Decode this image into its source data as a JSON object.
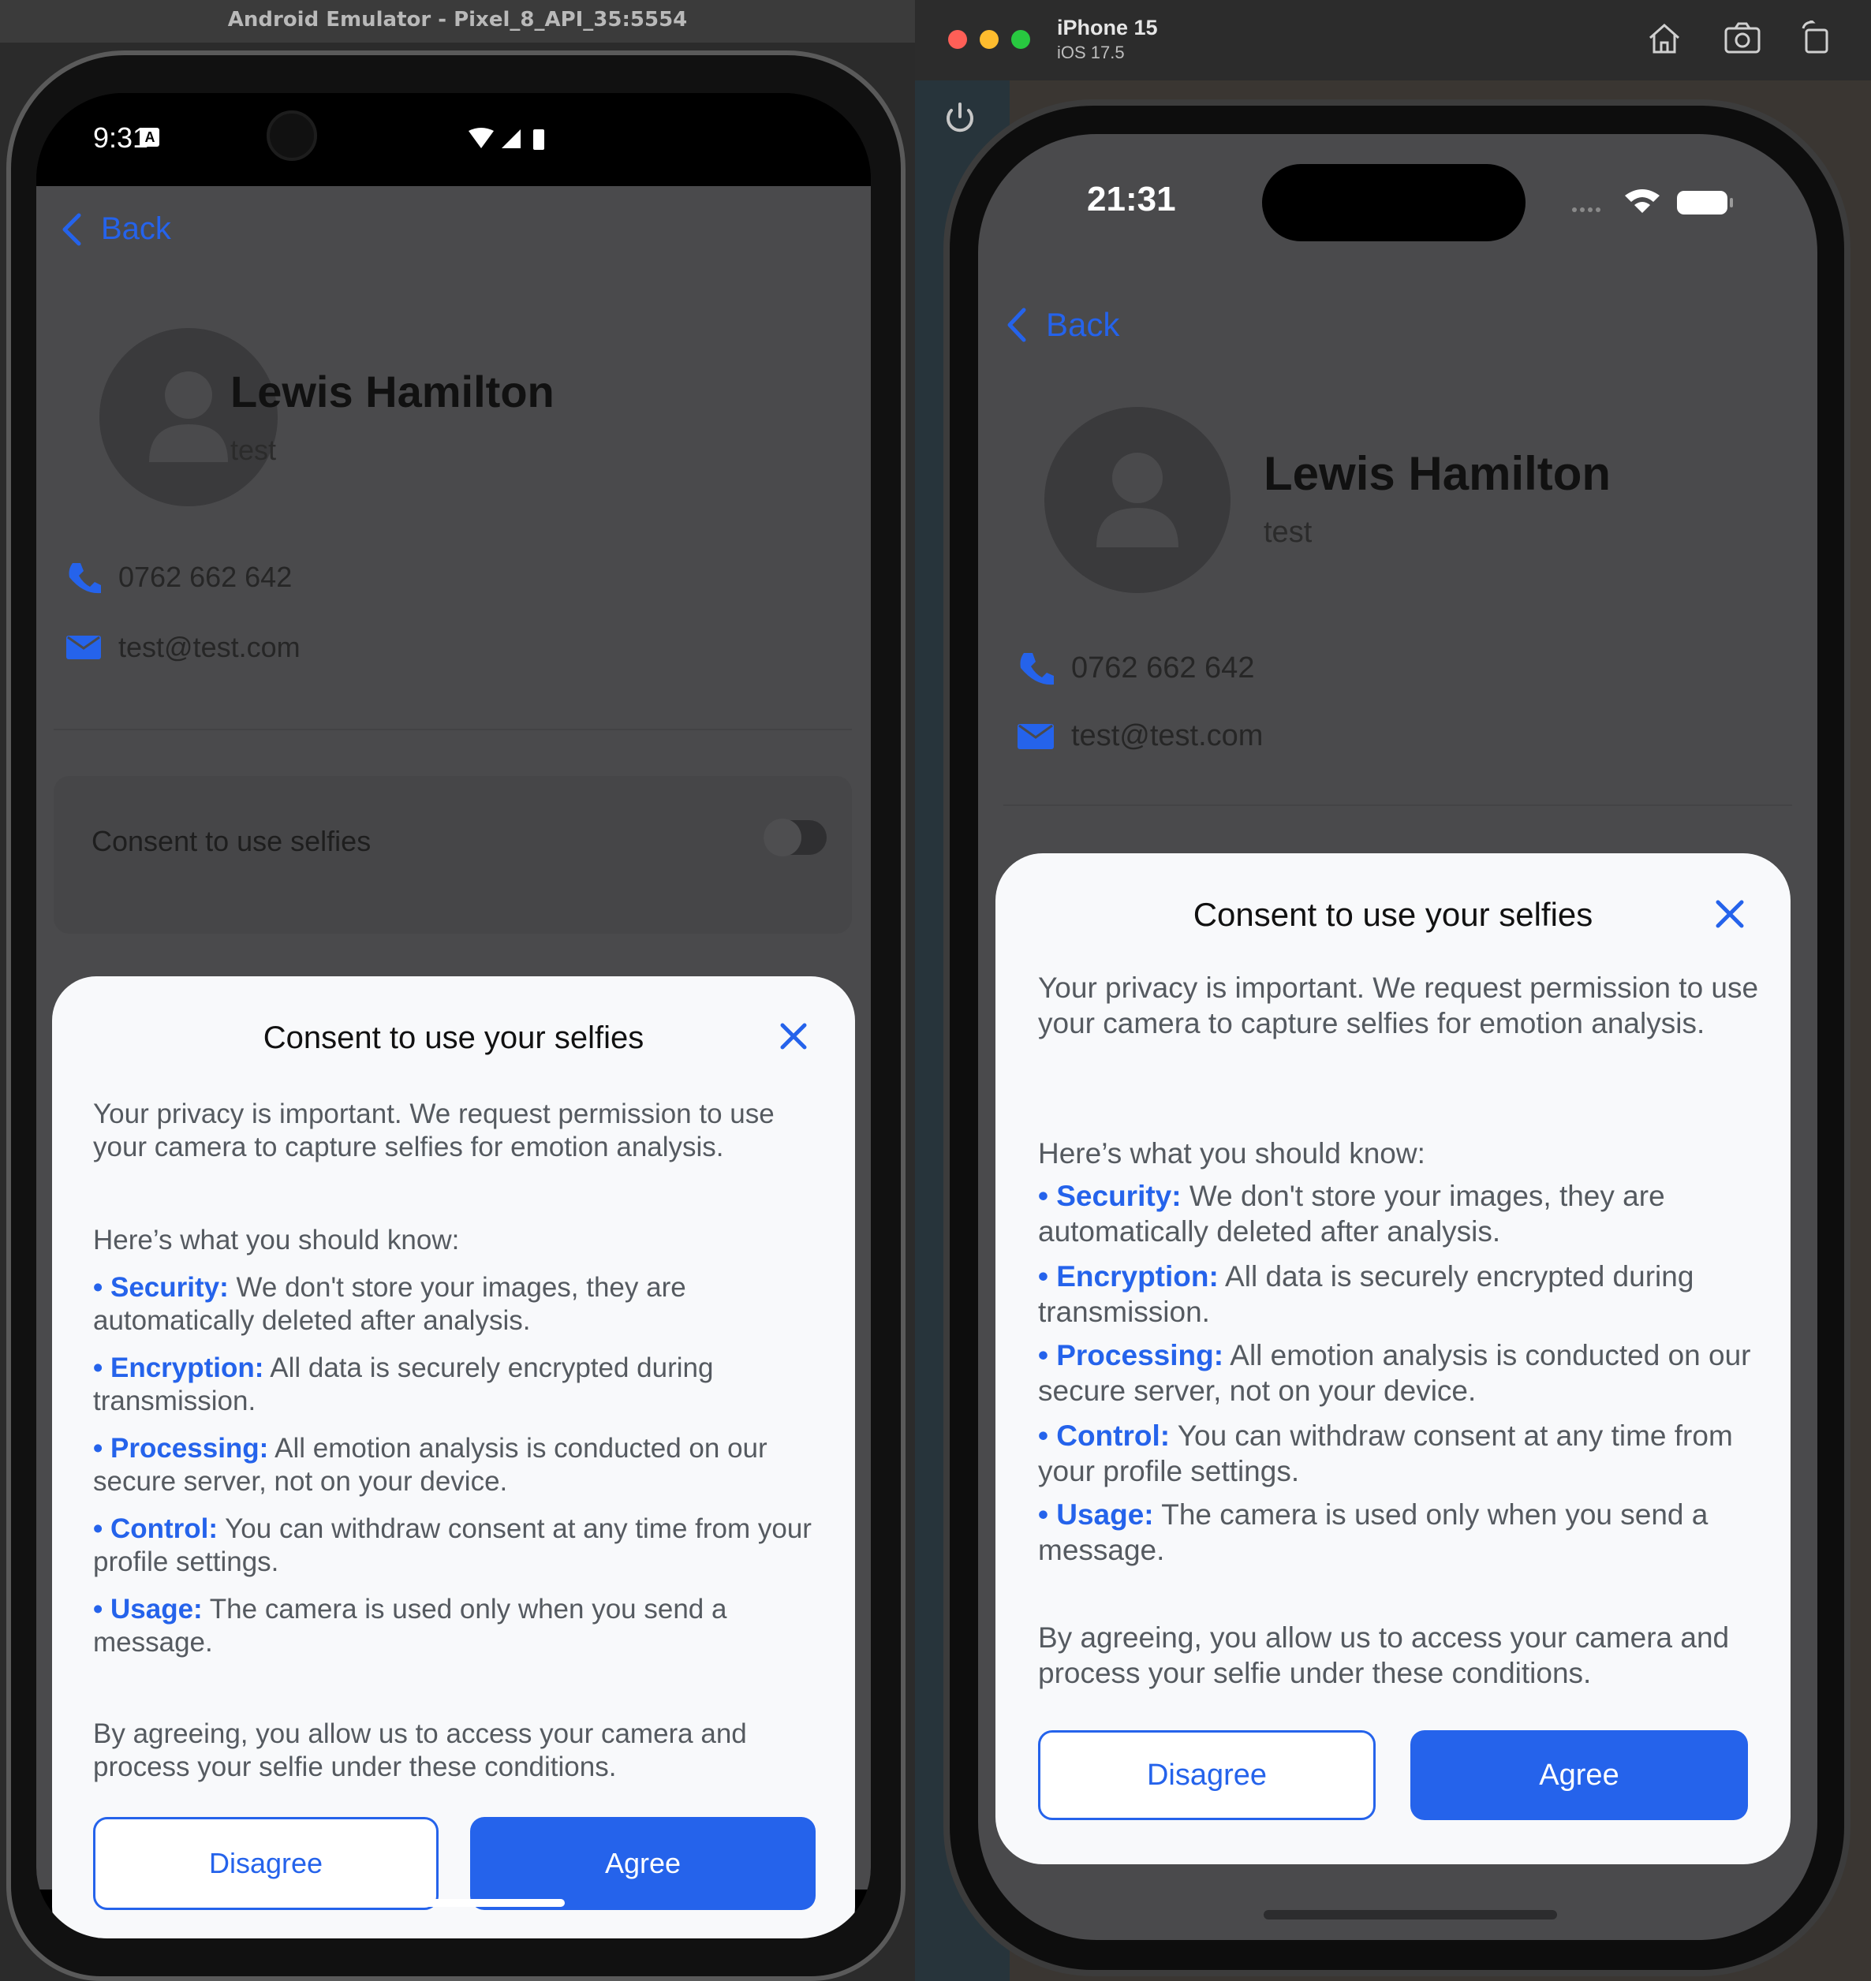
{
  "android": {
    "window_title": "Android Emulator - Pixel_8_API_35:5554",
    "status_time": "9:31",
    "status_notif": "A"
  },
  "ios": {
    "device_name": "iPhone 15",
    "os_version": "iOS 17.5",
    "status_time": "21:31"
  },
  "profile": {
    "back_label": "Back",
    "name": "Lewis Hamilton",
    "subtitle": "test",
    "phone": "0762 662 642",
    "email": "test@test.com",
    "consent_row_label": "Consent to use selfies"
  },
  "modal": {
    "title": "Consent to use your selfies",
    "intro": "Your privacy is important. We request permission to use your camera to capture selfies for emotion analysis.",
    "know_heading": "Here’s what you should know:",
    "items": [
      {
        "label": "Security:",
        "text": "We don't store your images, they are automatically deleted after analysis."
      },
      {
        "label": "Encryption:",
        "text": "All data is securely encrypted during transmission."
      },
      {
        "label": "Processing:",
        "text": "All emotion analysis is conducted on our secure server, not on your device."
      },
      {
        "label": "Control:",
        "text": "You can withdraw consent at any time from your profile settings."
      },
      {
        "label": "Usage:",
        "text": "The camera is used only when you send a message."
      }
    ],
    "footer": "By agreeing, you allow us to access your camera and process your selfie under these conditions.",
    "disagree_label": "Disagree",
    "agree_label": "Agree"
  },
  "colors": {
    "accent": "#2563eb",
    "backdrop": "#4a4a4c",
    "sheet": "#f8f9fb"
  }
}
